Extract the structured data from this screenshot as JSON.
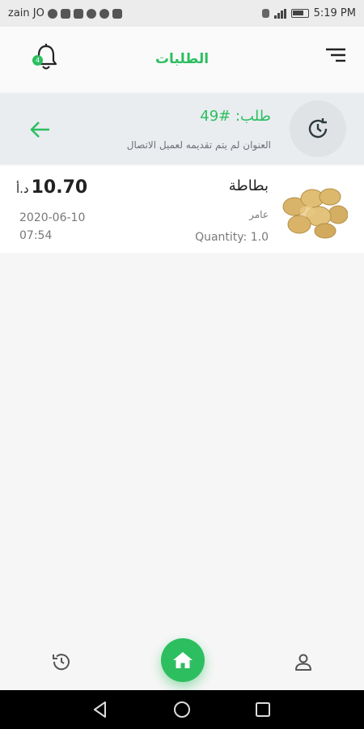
{
  "status_bar": {
    "carrier": "zain JO",
    "time": "5:19 PM",
    "icons": [
      "whatsapp-icon",
      "image-icon",
      "laptop-icon",
      "viber-icon",
      "messenger-icon",
      "facebook-icon",
      "sim-icon",
      "signal-icon",
      "battery-icon"
    ]
  },
  "app_bar": {
    "title": "الطلبات",
    "notification_count": "4"
  },
  "order": {
    "title": "طلب: #49",
    "subtitle": "العنوان لم يتم تقديمه لعميل الاتصال"
  },
  "product": {
    "name": "بطاطة",
    "seller": "عامر",
    "quantity": "Quantity: 1.0",
    "price": "10.70",
    "currency": "د.أ",
    "date": "2020-06-10",
    "time": "07:54"
  },
  "bottom_nav": {
    "items": [
      "history-icon",
      "home-icon",
      "profile-icon"
    ]
  },
  "colors": {
    "accent": "#2dbe60",
    "header_band": "#e9edf0"
  }
}
